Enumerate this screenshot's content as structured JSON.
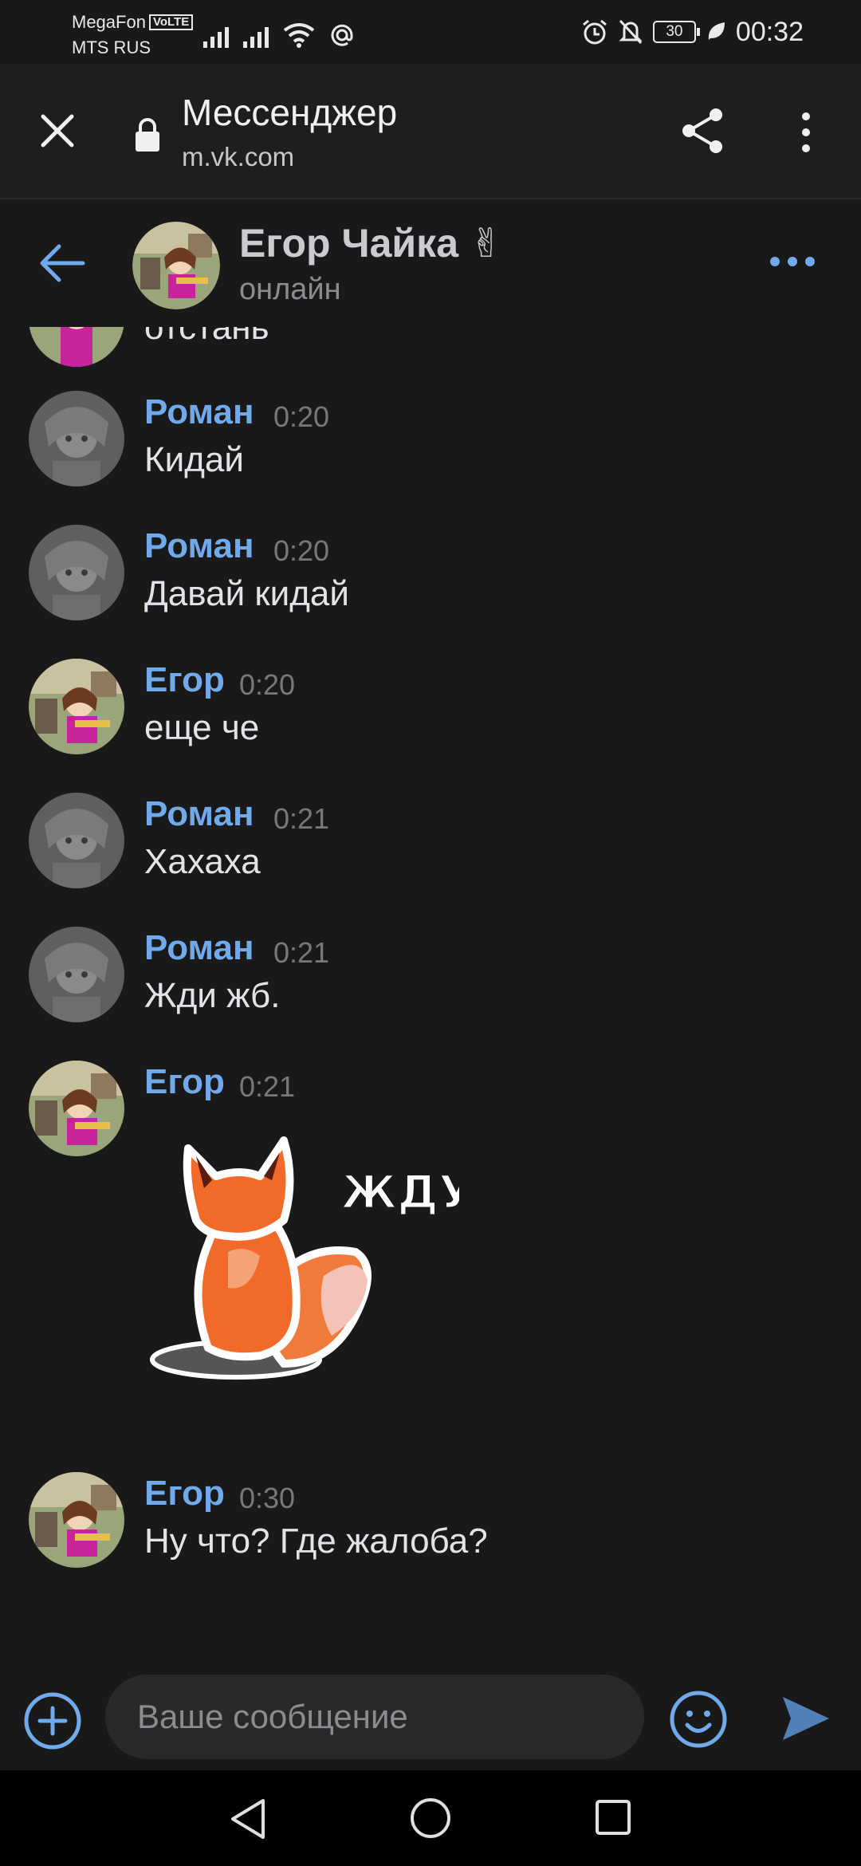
{
  "status_bar": {
    "carrier_1": "MegaFon",
    "volte": "VoLTE",
    "carrier_2": "MTS RUS",
    "battery": "30",
    "time": "00:32"
  },
  "browser": {
    "title": "Мессенджер",
    "url": "m.vk.com"
  },
  "chat": {
    "name": "Егор Чайка ✌",
    "status": "онлайн"
  },
  "messages": [
    {
      "text": "отстань",
      "partial": true
    },
    {
      "author": "Роман",
      "time": "0:20",
      "text": "Кидай"
    },
    {
      "author": "Роман",
      "time": "0:20",
      "text": "Давай кидай"
    },
    {
      "author": "Егор",
      "time": "0:20",
      "text": "еще че"
    },
    {
      "author": "Роман",
      "time": "0:21",
      "text": "Хахаха"
    },
    {
      "author": "Роман",
      "time": "0:21",
      "text": "Жди жб."
    },
    {
      "author": "Егор",
      "time": "0:21",
      "sticker": "fox-sticker",
      "sticker_text": "ЖДУ"
    },
    {
      "author": "Егор",
      "time": "0:30",
      "text": "Ну что? Где жалоба?"
    }
  ],
  "composer": {
    "placeholder": "Ваше сообщение"
  },
  "colors": {
    "background": "#191919",
    "accent": "#71aaeb",
    "text": "#e1e3e6",
    "muted": "#76787a"
  }
}
